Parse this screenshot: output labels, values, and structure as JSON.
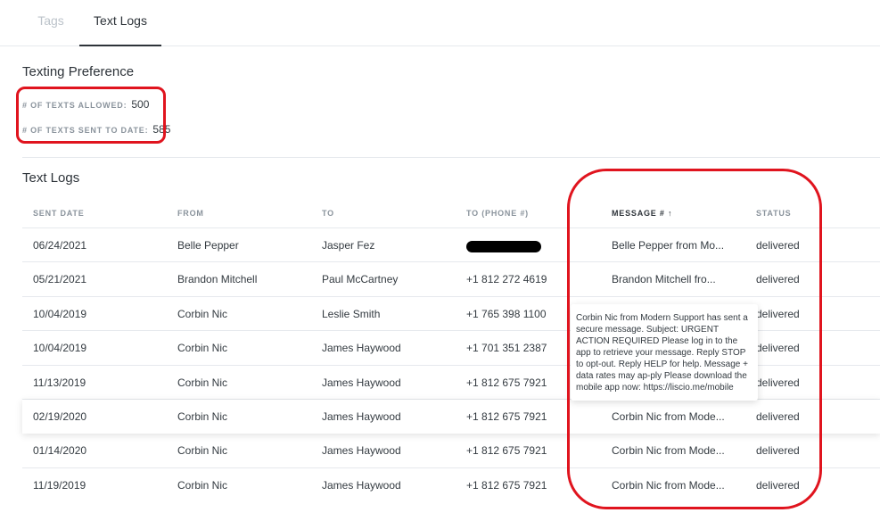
{
  "tabs": [
    {
      "label": "Tags"
    },
    {
      "label": "Text Logs"
    }
  ],
  "preference": {
    "title": "Texting Preference",
    "allowed_label": "# OF TEXTS ALLOWED:",
    "allowed_value": "500",
    "sent_label": "# OF TEXTS SENT TO DATE:",
    "sent_value": "585"
  },
  "logs": {
    "title": "Text Logs",
    "columns": [
      "SENT DATE",
      "FROM",
      "TO",
      "TO (PHONE #)",
      "MESSAGE # ↑",
      "STATUS"
    ],
    "rows": [
      {
        "date": "06/24/2021",
        "from": "Belle Pepper",
        "to": "Jasper Fez",
        "phone": "",
        "message": "Belle Pepper from Mo...",
        "status": "delivered"
      },
      {
        "date": "05/21/2021",
        "from": "Brandon Mitchell",
        "to": "Paul McCartney",
        "phone": "+1 812 272 4619",
        "message": "Brandon Mitchell fro...",
        "status": "delivered"
      },
      {
        "date": "10/04/2019",
        "from": "Corbin Nic",
        "to": "Leslie Smith",
        "phone": "+1 765 398 1100",
        "message": "",
        "status": "delivered"
      },
      {
        "date": "10/04/2019",
        "from": "Corbin Nic",
        "to": "James Haywood",
        "phone": "+1 701 351 2387",
        "message": "",
        "status": "delivered"
      },
      {
        "date": "11/13/2019",
        "from": "Corbin Nic",
        "to": "James Haywood",
        "phone": "+1 812 675 7921",
        "message": "",
        "status": "delivered"
      },
      {
        "date": "02/19/2020",
        "from": "Corbin Nic",
        "to": "James Haywood",
        "phone": "+1 812 675 7921",
        "message": "Corbin Nic from Mode...",
        "status": "delivered"
      },
      {
        "date": "01/14/2020",
        "from": "Corbin Nic",
        "to": "James Haywood",
        "phone": "+1 812 675 7921",
        "message": "Corbin Nic from Mode...",
        "status": "delivered"
      },
      {
        "date": "11/19/2019",
        "from": "Corbin Nic",
        "to": "James Haywood",
        "phone": "+1 812 675 7921",
        "message": "Corbin Nic from Mode...",
        "status": "delivered"
      }
    ]
  },
  "tooltip": {
    "text": "Corbin Nic from Modern Support has sent a secure message. Subject: URGENT ACTION REQUIRED Please log in to the app to retrieve your message. Reply STOP to opt-out. Reply HELP for help. Message + data rates may ap-ply Please download the mobile app now: https://liscio.me/mobile"
  },
  "colors": {
    "highlight": "#e0141e",
    "active_tab": "#2d3339",
    "inactive_tab": "#bcc3ca"
  }
}
